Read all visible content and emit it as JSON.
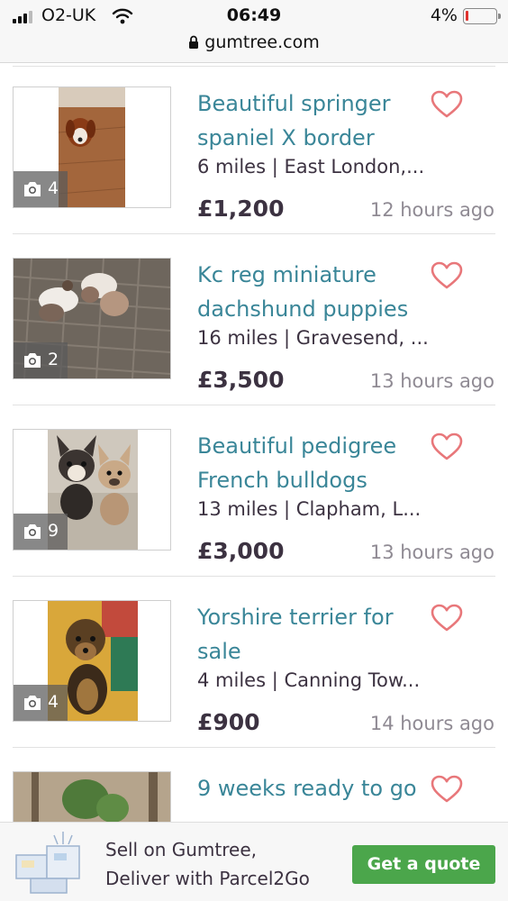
{
  "status_bar": {
    "carrier": "O2-UK",
    "time": "06:49",
    "battery": "4%",
    "battery_level": 0.04
  },
  "browser": {
    "url": "gumtree.com"
  },
  "listings": [
    {
      "title": "Beautiful springer spaniel X border",
      "location": "6 miles | East London,...",
      "price": "£1,200",
      "posted": "12 hours ago",
      "photo_count": "4",
      "photo_subject": "springer spaniel puppy on wooden floor"
    },
    {
      "title": "Kc reg miniature dachshund puppies",
      "location": "16 miles | Gravesend, ...",
      "price": "£3,500",
      "posted": "13 hours ago",
      "photo_count": "2",
      "photo_subject": "dachshund puppies on a woven mat"
    },
    {
      "title": "Beautiful pedigree French bulldogs",
      "location": "13 miles | Clapham, L...",
      "price": "£3,000",
      "posted": "13 hours ago",
      "photo_count": "9",
      "photo_subject": "two French bulldogs on a sofa"
    },
    {
      "title": "Yorshire terrier for sale",
      "location": "4 miles | Canning Tow...",
      "price": "£900",
      "posted": "14 hours ago",
      "photo_count": "4",
      "photo_subject": "yorkshire terrier on yellow cushion"
    },
    {
      "title": "9 weeks ready to go",
      "location": "",
      "price": "",
      "posted": "",
      "photo_count": "",
      "photo_subject": "puppy in a garden"
    }
  ],
  "banner": {
    "line1": "Sell on Gumtree,",
    "line2": "Deliver with Parcel2Go",
    "button": "Get a quote"
  },
  "colors": {
    "title": "#3a8698",
    "text": "#3c3241",
    "muted": "#8f8a93",
    "heart": "#e8777a",
    "button": "#4ba64b"
  }
}
